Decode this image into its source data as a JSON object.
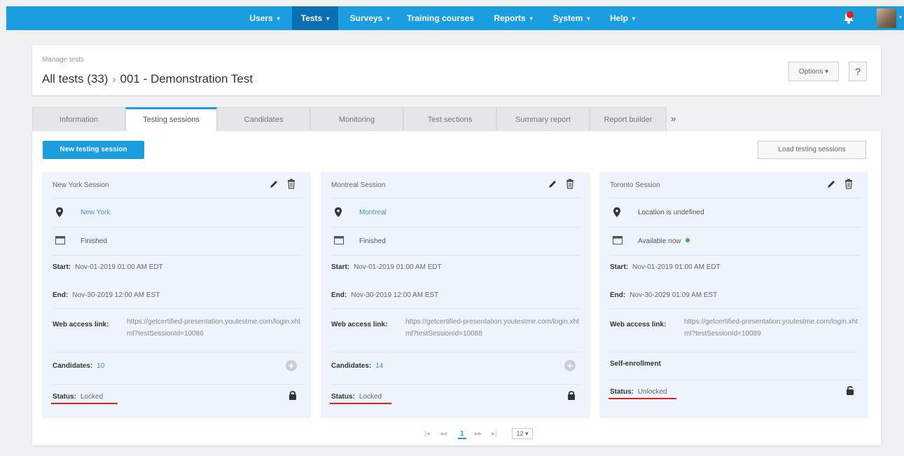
{
  "nav": {
    "items": [
      {
        "label": "Users",
        "dropdown": true
      },
      {
        "label": "Tests",
        "dropdown": true,
        "active": true
      },
      {
        "label": "Surveys",
        "dropdown": true
      },
      {
        "label": "Training courses",
        "dropdown": false
      },
      {
        "label": "Reports",
        "dropdown": true
      },
      {
        "label": "System",
        "dropdown": true
      },
      {
        "label": "Help",
        "dropdown": true
      }
    ],
    "caret": "▾",
    "colors": {
      "bar": "#1b9de2",
      "active": "#0a6fb3"
    }
  },
  "header": {
    "breadcrumb_small": "Manage tests",
    "title_root": "All tests (33)",
    "separator": "›",
    "title_current": "001 - Demonstration Test",
    "options_label": "Options ▾",
    "help_label": "?"
  },
  "tabs": [
    {
      "label": "Information"
    },
    {
      "label": "Testing sessions",
      "active": true
    },
    {
      "label": "Candidates"
    },
    {
      "label": "Monitoring"
    },
    {
      "label": "Test sections"
    },
    {
      "label": "Summary report"
    },
    {
      "label": "Report builder"
    }
  ],
  "tabs_more": "»",
  "toolbar": {
    "new_session_label": "New testing session",
    "load_sessions_label": "Load testing sessions"
  },
  "sessions": [
    {
      "title": "New York Session",
      "location": "New York",
      "location_defined": true,
      "state": "Finished",
      "start_label": "Start:",
      "start": "Nov-01-2019 01:00 AM EDT",
      "end_label": "End:",
      "end": "Nov-30-2019 12:00 AM EST",
      "web_label": "Web access link:",
      "web_link": "https://getcertified-presentation.youtestme.com/login.xhtml?testSessionId=10086",
      "candidates_label": "Candidates:",
      "candidates": "10",
      "status_label": "Status:",
      "status": "Locked"
    },
    {
      "title": "Montreal Session",
      "location": "Montreal",
      "location_defined": true,
      "state": "Finished",
      "start_label": "Start:",
      "start": "Nov-01-2019 01:00 AM EDT",
      "end_label": "End:",
      "end": "Nov-30-2019 12:00 AM EST",
      "web_label": "Web access link:",
      "web_link": "https://getcertified-presentation.youtestme.com/login.xhtml?testSessionId=10088",
      "candidates_label": "Candidates:",
      "candidates": "14",
      "status_label": "Status:",
      "status": "Locked"
    },
    {
      "title": "Toronto Session",
      "location": "Location is undefined",
      "location_defined": false,
      "state": "Available now",
      "start_label": "Start:",
      "start": "Nov-01-2019 01:00 AM EDT",
      "end_label": "End:",
      "end": "Nov-30-2029 01:09 AM EST",
      "web_label": "Web access link:",
      "web_link": "https://getcertified-presentation.youtestme.com/login.xhtml?testSessionId=10089",
      "enrollment": "Self-enrollment",
      "status_label": "Status:",
      "status": "Unlocked"
    }
  ],
  "pagination": {
    "first": "|◂",
    "prev": "◂◂",
    "current": "1",
    "next": "▸▸",
    "last": "▸|",
    "page_size": "12 ▾"
  },
  "colors": {
    "accent": "#1b9de2",
    "highlight": "#e21e1e",
    "available": "#36b24a"
  }
}
